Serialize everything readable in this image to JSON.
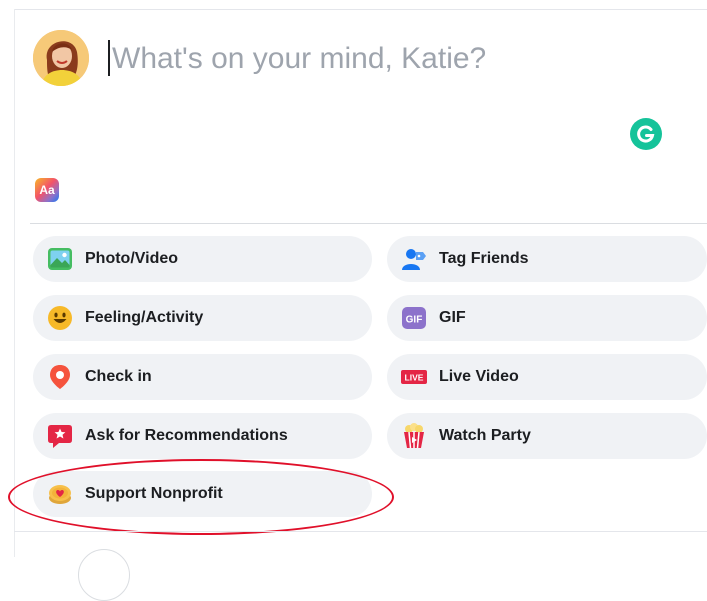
{
  "composer": {
    "placeholder": "What's on your mind, Katie?"
  },
  "options": [
    {
      "key": "photo",
      "label": "Photo/Video",
      "icon": "photo-video-icon"
    },
    {
      "key": "tag",
      "label": "Tag Friends",
      "icon": "tag-friends-icon"
    },
    {
      "key": "feeling",
      "label": "Feeling/Activity",
      "icon": "feeling-activity-icon"
    },
    {
      "key": "gif",
      "label": "GIF",
      "icon": "gif-icon"
    },
    {
      "key": "checkin",
      "label": "Check in",
      "icon": "check-in-icon"
    },
    {
      "key": "live",
      "label": "Live Video",
      "icon": "live-video-icon"
    },
    {
      "key": "ask",
      "label": "Ask for Recommendations",
      "icon": "ask-recommendations-icon"
    },
    {
      "key": "watch",
      "label": "Watch Party",
      "icon": "watch-party-icon"
    },
    {
      "key": "nonprofit",
      "label": "Support Nonprofit",
      "icon": "support-nonprofit-icon"
    }
  ],
  "icons": {
    "gif_badge": "GIF",
    "live_badge": "LIVE",
    "bg_picker": "Aa"
  },
  "colors": {
    "option_bg": "#f0f2f5",
    "grammarly_green": "#15c39a",
    "highlight_red": "#e0102a"
  }
}
